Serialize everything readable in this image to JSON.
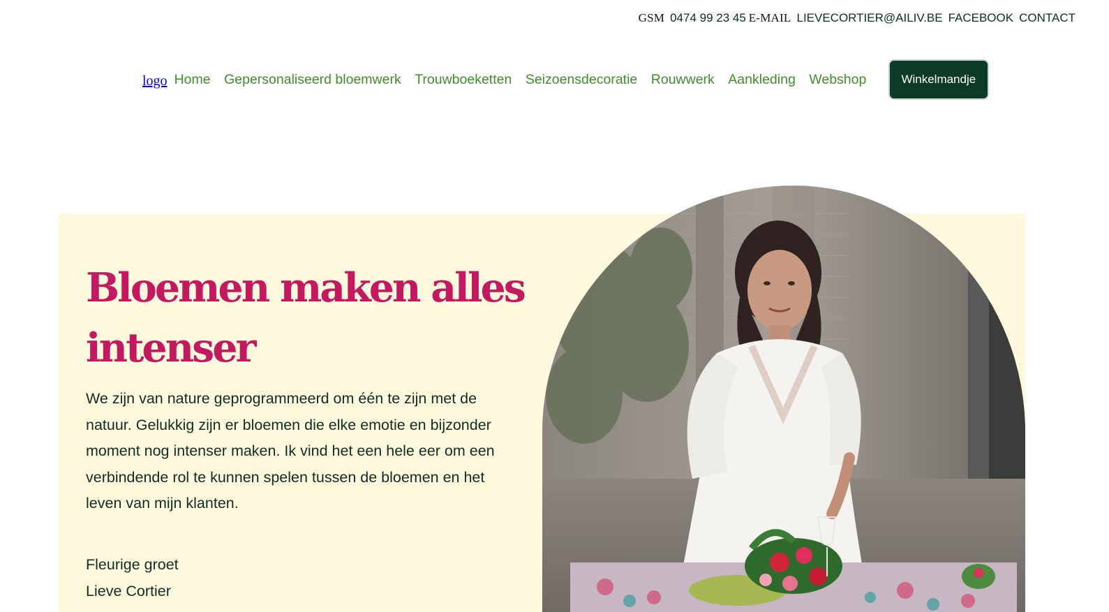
{
  "topbar": {
    "gsm_label": "GSM",
    "gsm_value": "0474 99 23 45",
    "email_label": "E-MAIL",
    "email_value": "LIEVECORTIER@AILIV.BE",
    "facebook": "FACEBOOK",
    "contact": "CONTACT"
  },
  "nav": {
    "logo": "logo",
    "items": [
      "Home",
      "Gepersonaliseerd bloemwerk",
      "Trouwboeketten",
      "Seizoensdecoratie",
      "Rouwwerk",
      "Aankleding",
      "Webshop"
    ],
    "cart": "Winkelmandje"
  },
  "hero": {
    "title": "Bloemen maken alles intenser",
    "text": "We zijn van nature geprogrammeerd om één te zijn met de natuur. Gelukkig zijn er bloemen die elke emotie en bijzonder moment nog intenser maken. Ik vind het een hele eer om een verbindende rol te kunnen spelen tussen de bloemen en het leven van mijn klanten.",
    "greeting": "Fleurige groet",
    "signature": "Lieve Cortier"
  },
  "colors": {
    "title": "#c4185f",
    "nav_link": "#3c8f2a",
    "cart_bg": "#0b3a26",
    "hero_bg": "#fef8dd",
    "body_text": "#0f2e22"
  },
  "icons": {
    "photo": "woman-with-flowers-photo"
  }
}
